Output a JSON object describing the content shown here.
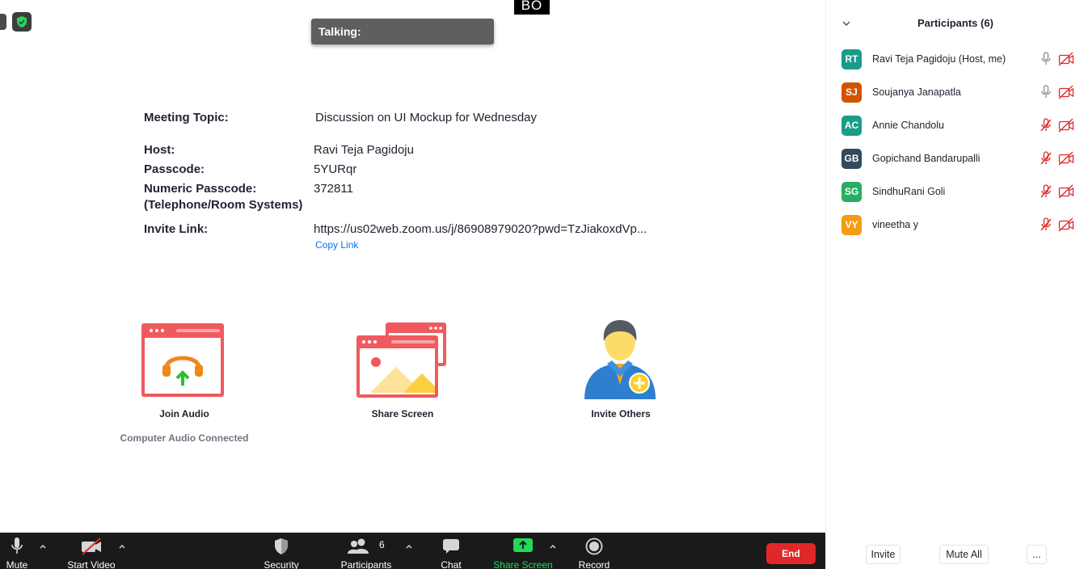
{
  "top": {
    "bo_tag": "BO",
    "talking_label": "Talking:"
  },
  "meeting": {
    "topic_label": "Meeting Topic:",
    "topic_value": "Discussion on UI Mockup for Wednesday",
    "host_label": "Host:",
    "host_value": "Ravi Teja Pagidoju",
    "passcode_label": "Passcode:",
    "passcode_value": "5YURqr",
    "numeric_passcode_label_line1": "Numeric Passcode:",
    "numeric_passcode_label_line2": "(Telephone/Room Systems)",
    "numeric_passcode_value": "372811",
    "invite_link_label": "Invite Link:",
    "invite_link_value": "https://us02web.zoom.us/j/86908979020?pwd=TzJiakoxdVp...",
    "copy_link": "Copy Link"
  },
  "actions": {
    "join_audio": "Join Audio",
    "join_audio_status": "Computer Audio Connected",
    "share_screen": "Share Screen",
    "invite_others": "Invite Others"
  },
  "participants_panel": {
    "title": "Participants (6)",
    "participants": [
      {
        "initials": "RT",
        "name": "Ravi Teja Pagidoju (Host, me)",
        "color": "#1a9c8a",
        "mic": "on",
        "video": "off"
      },
      {
        "initials": "SJ",
        "name": "Soujanya Janapatla",
        "color": "#d35400",
        "mic": "on",
        "video": "off"
      },
      {
        "initials": "AC",
        "name": "Annie Chandolu",
        "color": "#1a9c8a",
        "mic": "muted",
        "video": "off"
      },
      {
        "initials": "GB",
        "name": "Gopichand Bandarupalli",
        "color": "#34495e",
        "mic": "muted",
        "video": "off"
      },
      {
        "initials": "SG",
        "name": "SindhuRani Goli",
        "color": "#27ae60",
        "mic": "muted",
        "video": "off"
      },
      {
        "initials": "VY",
        "name": "vineetha y",
        "color": "#f39c12",
        "mic": "muted",
        "video": "off"
      }
    ],
    "invite_button": "Invite",
    "mute_all_button": "Mute All",
    "more_button": "..."
  },
  "toolbar": {
    "mute": "Mute",
    "start_video": "Start Video",
    "security": "Security",
    "participants": "Participants",
    "participants_count": "6",
    "chat": "Chat",
    "share_screen": "Share Screen",
    "record": "Record",
    "end": "End"
  },
  "colors": {
    "accent_blue": "#0e71eb",
    "share_green": "#23d959",
    "end_red": "#e02828",
    "muted_red": "#e02828",
    "toolbar_bg": "#1a1a1a"
  }
}
